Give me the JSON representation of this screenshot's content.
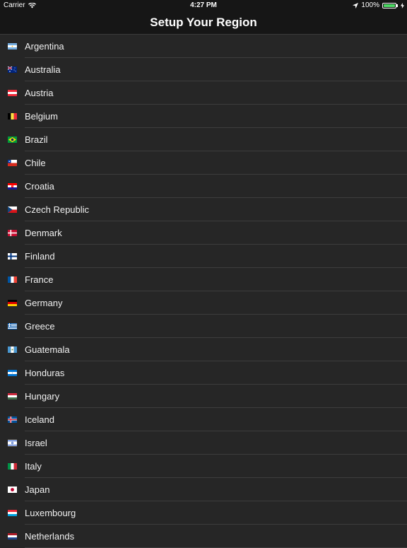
{
  "status_bar": {
    "carrier": "Carrier",
    "time": "4:27 PM",
    "battery": "100%"
  },
  "nav": {
    "title": "Setup Your Region"
  },
  "countries": [
    {
      "name": "Argentina",
      "flag": "argentina-flag-icon"
    },
    {
      "name": "Australia",
      "flag": "australia-flag-icon"
    },
    {
      "name": "Austria",
      "flag": "austria-flag-icon"
    },
    {
      "name": "Belgium",
      "flag": "belgium-flag-icon"
    },
    {
      "name": "Brazil",
      "flag": "brazil-flag-icon"
    },
    {
      "name": "Chile",
      "flag": "chile-flag-icon"
    },
    {
      "name": "Croatia",
      "flag": "croatia-flag-icon"
    },
    {
      "name": "Czech Republic",
      "flag": "czech-flag-icon"
    },
    {
      "name": "Denmark",
      "flag": "denmark-flag-icon"
    },
    {
      "name": "Finland",
      "flag": "finland-flag-icon"
    },
    {
      "name": "France",
      "flag": "france-flag-icon"
    },
    {
      "name": "Germany",
      "flag": "germany-flag-icon"
    },
    {
      "name": "Greece",
      "flag": "greece-flag-icon"
    },
    {
      "name": "Guatemala",
      "flag": "guatemala-flag-icon"
    },
    {
      "name": "Honduras",
      "flag": "honduras-flag-icon"
    },
    {
      "name": "Hungary",
      "flag": "hungary-flag-icon"
    },
    {
      "name": "Iceland",
      "flag": "iceland-flag-icon"
    },
    {
      "name": "Israel",
      "flag": "israel-flag-icon"
    },
    {
      "name": "Italy",
      "flag": "italy-flag-icon"
    },
    {
      "name": "Japan",
      "flag": "japan-flag-icon"
    },
    {
      "name": "Luxembourg",
      "flag": "luxembourg-flag-icon"
    },
    {
      "name": "Netherlands",
      "flag": "netherlands-flag-icon"
    }
  ]
}
